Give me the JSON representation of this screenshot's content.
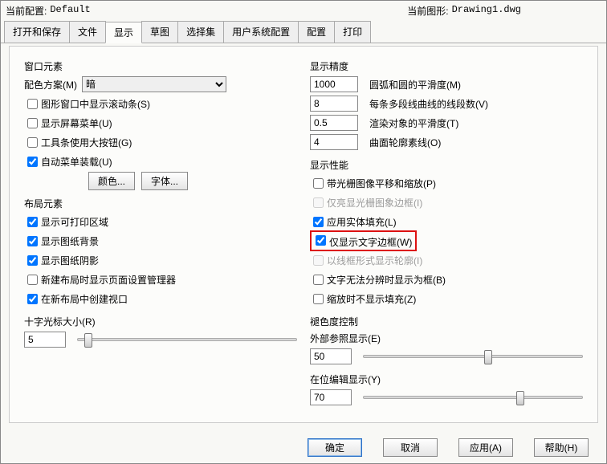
{
  "header": {
    "currentConfigLabel": "当前配置:",
    "currentConfigValue": "Default",
    "currentDrawingLabel": "当前图形:",
    "currentDrawingValue": "Drawing1.dwg"
  },
  "tabs": {
    "t0": "打开和保存",
    "t1": "文件",
    "t2": "显示",
    "t3": "草图",
    "t4": "选择集",
    "t5": "用户系统配置",
    "t6": "配置",
    "t7": "打印"
  },
  "left": {
    "windowElements": {
      "title": "窗口元素",
      "colorSchemeLabel": "配色方案(M)",
      "colorSchemeValue": "暗",
      "scrollbars": "图形窗口中显示滚动条(S)",
      "screenMenu": "显示屏幕菜单(U)",
      "bigButtons": "工具条使用大按钮(G)",
      "autoMenu": "自动菜单装载(U)",
      "colorBtn": "颜色...",
      "fontBtn": "字体..."
    },
    "layoutElements": {
      "title": "布局元素",
      "printable": "显示可打印区域",
      "paperBg": "显示图纸背景",
      "paperShadow": "显示图纸阴影",
      "pageSetup": "新建布局时显示页面设置管理器",
      "createViewport": "在新布局中创建视口"
    },
    "crosshair": {
      "title": "十字光标大小(R)",
      "value": "5"
    }
  },
  "right": {
    "precision": {
      "title": "显示精度",
      "arcVal": "1000",
      "arcLbl": "圆弧和圆的平滑度(M)",
      "segVal": "8",
      "segLbl": "每条多段线曲线的线段数(V)",
      "renderVal": "0.5",
      "renderLbl": "渲染对象的平滑度(T)",
      "surfVal": "4",
      "surfLbl": "曲面轮廓素线(O)"
    },
    "performance": {
      "title": "显示性能",
      "rasterPan": "带光栅图像平移和缩放(P)",
      "rasterFrame": "仅亮显光栅图象边框(I)",
      "solidFill": "应用实体填充(L)",
      "textFrame": "仅显示文字边框(W)",
      "wireframe": "以线框形式显示轮廓(I)",
      "noResolve": "文字无法分辨时显示为框(B)",
      "noZoomFill": "缩放时不显示填充(Z)"
    },
    "fade": {
      "title": "褪色度控制",
      "xrefLabel": "外部参照显示(E)",
      "xrefVal": "50",
      "inplaceLabel": "在位编辑显示(Y)",
      "inplaceVal": "70"
    }
  },
  "footer": {
    "ok": "确定",
    "cancel": "取消",
    "apply": "应用(A)",
    "help": "帮助(H)"
  }
}
